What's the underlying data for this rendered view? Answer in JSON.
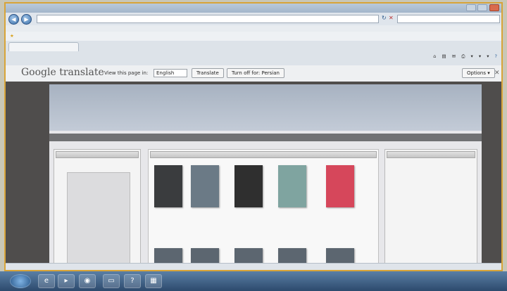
{
  "browser": {
    "address": "",
    "search_placeholder": "",
    "site_tab": "",
    "status_url": "",
    "status_zone": "",
    "zoom": ""
  },
  "translate_bar": {
    "logo": "Google translate",
    "view_label": "View this page in:",
    "language": "English",
    "translate_button": "Translate",
    "turn_off_button": "Turn off for: Persian",
    "options_button": "Options ▾"
  },
  "site": {
    "title": "",
    "nav": [],
    "categories": []
  },
  "ad": {
    "line1": "",
    "line2": "",
    "line3": "",
    "line4": ""
  },
  "books": [
    {
      "title": "",
      "price": "",
      "color": "#3a3c3e"
    },
    {
      "title": "",
      "price": "",
      "color": "#6b7a86"
    },
    {
      "title": "",
      "price": "",
      "color": "#2f2f2f"
    },
    {
      "title": "",
      "price": "",
      "color": "#7fa4a0"
    },
    {
      "title": "",
      "price": "",
      "color": "#d6475b"
    }
  ]
}
